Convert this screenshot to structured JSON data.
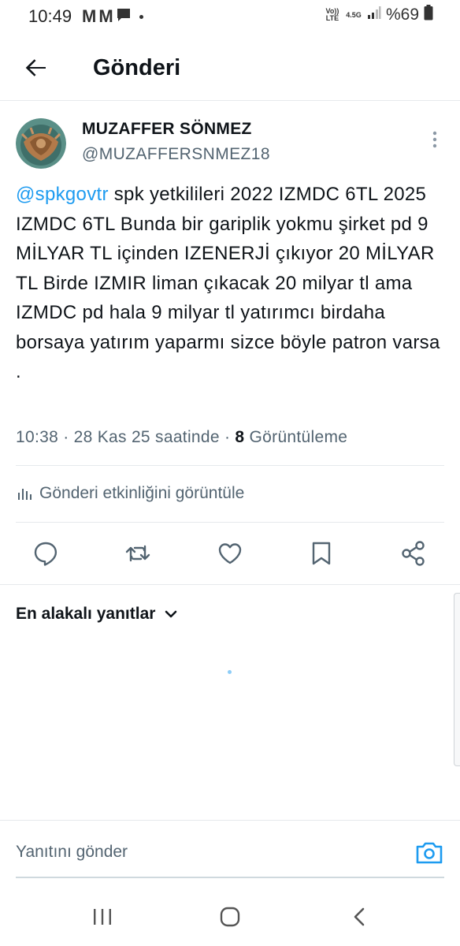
{
  "status_bar": {
    "time": "10:49",
    "notif_m1": "M",
    "notif_m2": "M",
    "volte": "Vo)) LTE",
    "network": "4.5G",
    "battery_text": "%69"
  },
  "header": {
    "title": "Gönderi"
  },
  "post": {
    "author_name": "MUZAFFER SÖNMEZ",
    "author_handle": "@MUZAFFERSNMEZ18",
    "mention": "@spkgovtr",
    "body": " spk yetkilileri 2022 IZMDC 6TL 2025 IZMDC 6TL Bunda bir gariplik yokmu şirket pd 9 MİLYAR TL içinden IZENERJİ çıkıyor 20 MİLYAR TL Birde IZMIR liman çıkacak 20 milyar tl ama IZMDC pd hala 9 milyar tl yatırımcı birdaha borsaya yatırım yaparmı sizce böyle patron varsa .",
    "time": "10:38",
    "date": "28 Kas 25 saatinde",
    "views_count": "8",
    "views_label": "Görüntüleme",
    "activity_label": "Gönderi etkinliğini görüntüle"
  },
  "replies": {
    "sort_label": "En alakalı yanıtlar"
  },
  "reply_bar": {
    "placeholder": "Yanıtını gönder"
  },
  "colors": {
    "accent": "#1d9bf0",
    "secondary_text": "#536471",
    "primary_text": "#0f1419",
    "divider": "#e6e9ec"
  },
  "icons": {
    "back": "arrow-left-icon",
    "more": "more-vertical-icon",
    "activity": "bar-chart-icon",
    "reply": "comment-icon",
    "retweet": "retweet-icon",
    "like": "heart-icon",
    "bookmark": "bookmark-icon",
    "share": "share-icon",
    "sort": "chevron-down-icon",
    "camera": "camera-icon"
  }
}
